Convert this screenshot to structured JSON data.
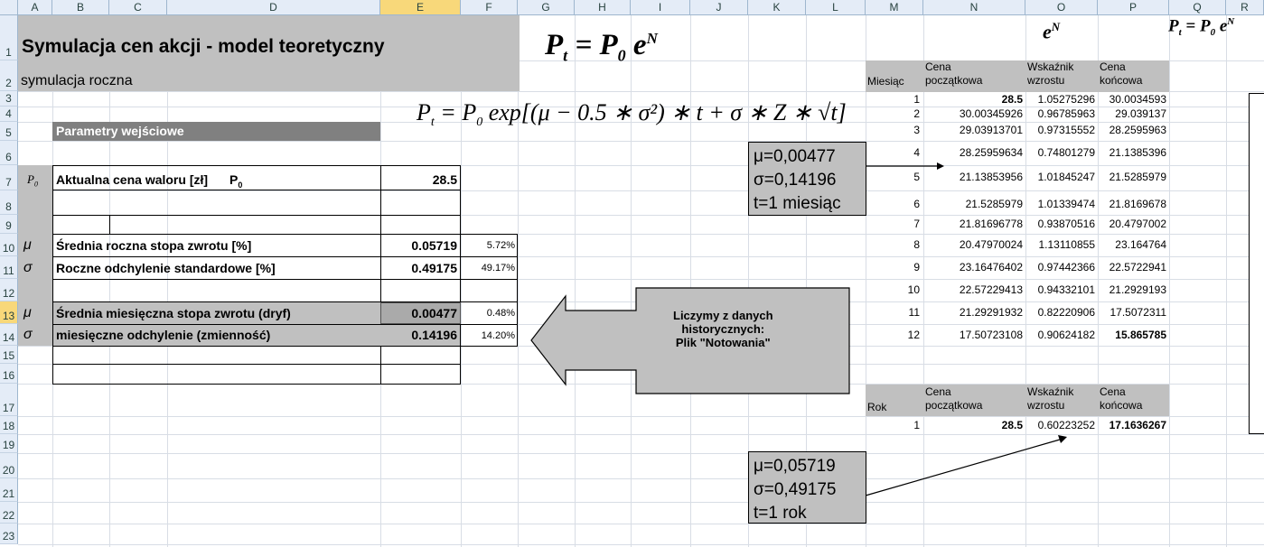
{
  "columns": [
    "A",
    "B",
    "C",
    "D",
    "E",
    "F",
    "G",
    "H",
    "I",
    "J",
    "K",
    "L",
    "M",
    "N",
    "O",
    "P",
    "Q",
    "R"
  ],
  "rows": [
    "1",
    "2",
    "3",
    "4",
    "5",
    "6",
    "7",
    "8",
    "9",
    "10",
    "11",
    "12",
    "13",
    "14",
    "15",
    "16",
    "17",
    "18",
    "19",
    "20",
    "21",
    "22",
    "23"
  ],
  "title": "Symulacja cen akcji - model teoretyczny",
  "subtitle": "symulacja roczna",
  "formula_main": {
    "lhs": "P",
    "lhs_sub": "t",
    "eq": " = ",
    "rhs": "P",
    "rhs_sub": "0",
    "exp_base": " e",
    "exp_sup": "N"
  },
  "formula_full": "exp[(μ − 0.5 ∗ σ²) ∗ t + σ ∗ Z ∗ √t]",
  "formula_eN": {
    "base": "e",
    "sup": "N"
  },
  "formula_small": {
    "lhs": "P",
    "lhs_sub": "t",
    "eq": " = ",
    "rhs": "P",
    "rhs_sub": "0",
    "exp_base": " e",
    "exp_sup": "N"
  },
  "params": {
    "header": "Parametry wejściowe",
    "p0_symbol": "P",
    "p0_sub": "0",
    "rows": {
      "price": {
        "label": "Aktualna cena waloru [zł]",
        "label_sym": "P",
        "label_sub": "0",
        "value": "28.5"
      },
      "annual_return": {
        "symbol": "μ",
        "label": "Średnia roczna stopa zwrotu [%]",
        "value": "0.05719",
        "pct": "5.72%"
      },
      "annual_sd": {
        "symbol": "σ",
        "label": "Roczne odchylenie standardowe [%]",
        "value": "0.49175",
        "pct": "49.17%"
      },
      "monthly_return": {
        "symbol": "μ",
        "label": "Średnia miesięczna stopa zwrotu (dryf)",
        "value": "0.00477",
        "pct": "0.48%"
      },
      "monthly_sd": {
        "symbol": "σ",
        "label": "miesięczne odchylenie (zmienność)",
        "value": "0.14196",
        "pct": "14.20%"
      }
    }
  },
  "callout_monthly": {
    "mu": "μ=0,00477",
    "sigma": "σ=0,14196",
    "t": "t=1 miesiąc"
  },
  "callout_annual": {
    "mu": "μ=0,05719",
    "sigma": "σ=0,49175",
    "t": "t=1 rok"
  },
  "arrow_note": {
    "line1": "Liczymy z danych",
    "line2": "historycznych:",
    "line3": "Plik \"Notowania\""
  },
  "monthly_table": {
    "headers": {
      "period": "Miesiąc",
      "start_1": "Cena",
      "start_2": "początkowa",
      "growth_1": "Wskaźnik",
      "growth_2": "wzrostu",
      "end_1": "Cena",
      "end_2": "końcowa"
    },
    "rows": [
      {
        "n": "1",
        "start": "28.5",
        "growth": "1.05275296",
        "end": "30.0034593"
      },
      {
        "n": "2",
        "start": "30.00345926",
        "growth": "0.96785963",
        "end": "29.039137"
      },
      {
        "n": "3",
        "start": "29.03913701",
        "growth": "0.97315552",
        "end": "28.2595963"
      },
      {
        "n": "4",
        "start": "28.25959634",
        "growth": "0.74801279",
        "end": "21.1385396"
      },
      {
        "n": "5",
        "start": "21.13853956",
        "growth": "1.01845247",
        "end": "21.5285979"
      },
      {
        "n": "6",
        "start": "21.5285979",
        "growth": "1.01339474",
        "end": "21.8169678"
      },
      {
        "n": "7",
        "start": "21.81696778",
        "growth": "0.93870516",
        "end": "20.4797002"
      },
      {
        "n": "8",
        "start": "20.47970024",
        "growth": "1.13110855",
        "end": "23.164764"
      },
      {
        "n": "9",
        "start": "23.16476402",
        "growth": "0.97442366",
        "end": "22.5722941"
      },
      {
        "n": "10",
        "start": "22.57229413",
        "growth": "0.94332101",
        "end": "21.2929193"
      },
      {
        "n": "11",
        "start": "21.29291932",
        "growth": "0.82220906",
        "end": "17.5072311"
      },
      {
        "n": "12",
        "start": "17.50723108",
        "growth": "0.90624182",
        "end": "15.865785"
      }
    ]
  },
  "annual_table": {
    "headers": {
      "period": "Rok",
      "start_1": "Cena",
      "start_2": "początkowa",
      "growth_1": "Wskaźnik",
      "growth_2": "wzrostu",
      "end_1": "Cena",
      "end_2": "końcowa"
    },
    "row": {
      "n": "1",
      "start": "28.5",
      "growth": "0.60223252",
      "end": "17.1636267"
    }
  }
}
